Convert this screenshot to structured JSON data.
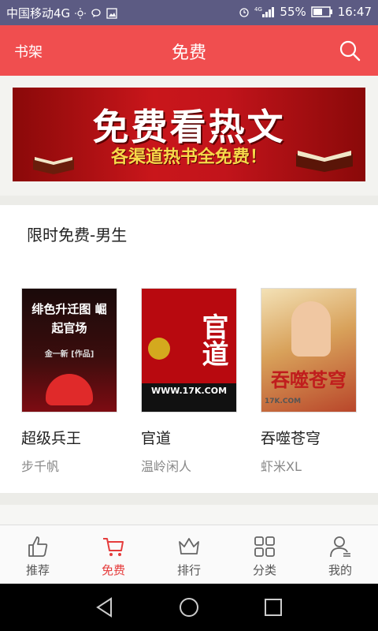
{
  "status": {
    "carrier": "中国移动4G",
    "battery": "55%",
    "time": "16:47",
    "network": "4G"
  },
  "header": {
    "shelf_label": "书架",
    "title": "免费"
  },
  "banner": {
    "headline": "免费看热文",
    "subline": "各渠道热书全免费！"
  },
  "section": {
    "title": "限时免费-男生",
    "books": [
      {
        "name": "超级兵王",
        "author": "步千帆",
        "cover_text": "绯色升迁图 崛起官场",
        "cover_sub": "金一新 [作品]"
      },
      {
        "name": "官道",
        "author": "温岭闲人",
        "cover_text": "官道",
        "cover_sub": "WWW.17K.COM"
      },
      {
        "name": "吞噬苍穹",
        "author": "虾米XL",
        "cover_text": "吞噬苍穹",
        "cover_sub": "17K.COM"
      }
    ]
  },
  "tabs": [
    {
      "label": "推荐",
      "icon": "thumbs-up-icon"
    },
    {
      "label": "免费",
      "icon": "cart-icon"
    },
    {
      "label": "排行",
      "icon": "crown-icon"
    },
    {
      "label": "分类",
      "icon": "grid-icon"
    },
    {
      "label": "我的",
      "icon": "user-icon"
    }
  ],
  "colors": {
    "header": "#f04e4f",
    "active_tab": "#e53c3c",
    "statusbar": "#5c5b83"
  }
}
